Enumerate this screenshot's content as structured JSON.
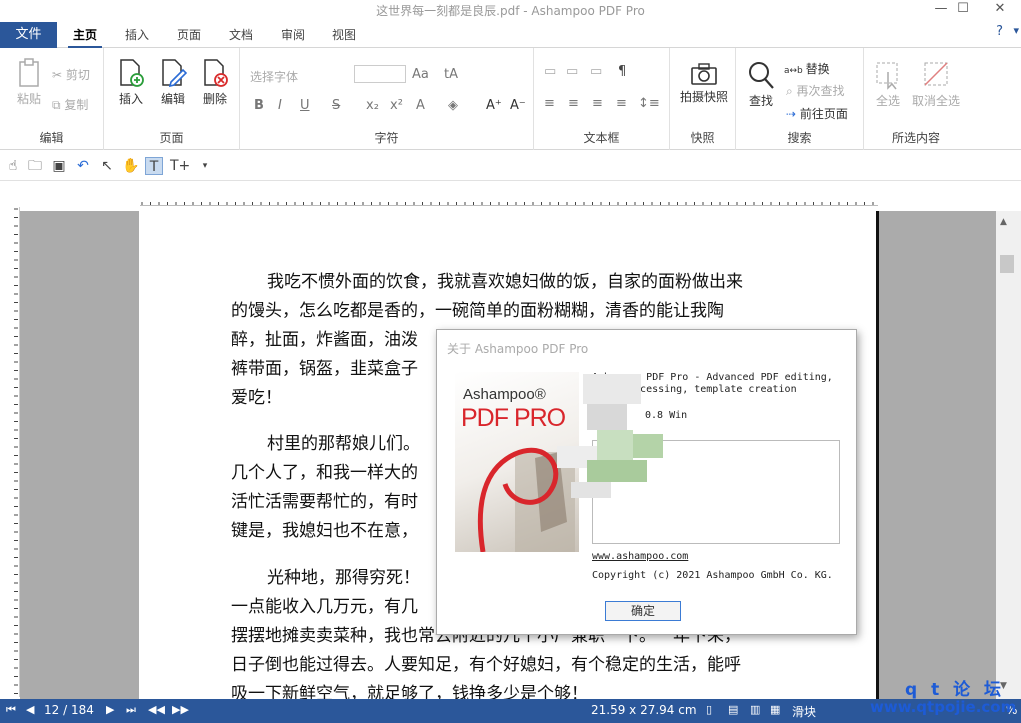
{
  "window": {
    "title": "这世界每一刻都是良辰.pdf - Ashampoo PDF Pro"
  },
  "menu": {
    "file": "文件",
    "tabs": [
      "主页",
      "插入",
      "页面",
      "文档",
      "审阅",
      "视图"
    ],
    "help": "?"
  },
  "ribbon": {
    "edit": {
      "label": "编辑",
      "paste": "粘贴",
      "cut": "剪切",
      "copy": "复制"
    },
    "page": {
      "label": "页面",
      "insert": "插入",
      "edit": "编辑",
      "delete": "删除"
    },
    "font": {
      "label": "字符",
      "font_placeholder": "选择字体"
    },
    "textbox": {
      "label": "文本框"
    },
    "snapshot": {
      "label": "快照",
      "take": "拍摄快照"
    },
    "search": {
      "label": "搜索",
      "find": "查找",
      "replace": "替换",
      "find_again": "再次查找",
      "goto_page": "前往页面"
    },
    "selection": {
      "label": "所选内容",
      "select_all": "全选",
      "deselect_all": "取消全选"
    }
  },
  "document": {
    "paragraphs": [
      [
        "我吃不惯外面的饮食，我就喜欢媳妇做的饭，自家的面粉做出来",
        "的馒头，怎么吃都是香的，一碗简单的面粉糊糊，清香的能让我陶",
        "醉，扯面，炸酱面，油泼",
        "裤带面，锅盔，韭菜盒子",
        "爱吃！"
      ],
      [
        "村里的那帮娘儿们。",
        "几个人了，和我一样大的",
        "活忙活需要帮忙的，有时",
        "键是，我媳妇也不在意，"
      ],
      [
        "光种地，那得穷死！",
        "一点能收入几万元，有几",
        "摆摆地摊卖卖菜种，我也常去附近的几个小厂兼职一下。一年下来，",
        "日子倒也能过得去。人要知足，有个好媳妇，有个稳定的生活，能呼",
        "吸一下新鲜空气，就足够了，钱挣多少是个够！"
      ]
    ]
  },
  "dialog": {
    "title": "关于 Ashampoo PDF Pro",
    "logo_brand": "Ashampoo®",
    "logo_product": "PDF PRO",
    "desc_line1": "Ashampoo PDF Pro - Advanced PDF editing,",
    "desc_line2": "processing, template creation",
    "version_fragment": "0.8 Win",
    "url": "www.ashampoo.com",
    "copyright": "Copyright (c) 2021 Ashampoo GmbH  Co. KG.",
    "ok": "确定"
  },
  "status": {
    "page": "12 / 184",
    "dimensions": "21.59 x 27.94 cm",
    "mode": "滑块",
    "zoom": "%"
  },
  "watermark": {
    "line1": "q t 论 坛",
    "line2": "www.qtpojie.com"
  },
  "colors": {
    "accent": "#2b579a",
    "logo_red": "#d9262c"
  }
}
